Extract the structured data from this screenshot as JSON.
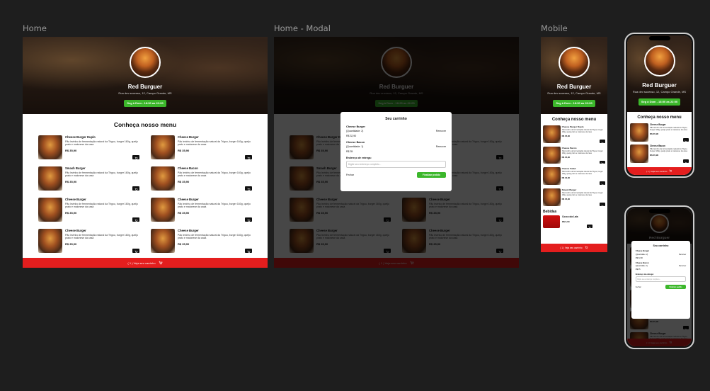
{
  "labels": {
    "home": "Home",
    "home_modal": "Home - Modal",
    "mobile": "Mobile"
  },
  "header": {
    "brand": "Red Burguer",
    "address": "Rua dev sucesso, 12, Campo Grande, MS",
    "hours": "Seg à Dom - 18:00 as 22:00"
  },
  "menu": {
    "title": "Conheça nosso menu",
    "desc": "Pão levinho de fermentação natural da Trigou, burger 160g, queijo prato e maionese da casa",
    "items": [
      {
        "name": "Cheese Burger Duplo",
        "price": "R$ 35,90"
      },
      {
        "name": "Cheese Burger",
        "price": "R$ 35,90"
      },
      {
        "name": "Smash Burger",
        "price": "R$ 35,90"
      },
      {
        "name": "Cheese Bacon",
        "price": "R$ 35,90"
      },
      {
        "name": "Cheese Burger",
        "price": "R$ 35,90"
      },
      {
        "name": "Cheese Burger",
        "price": "R$ 35,90"
      },
      {
        "name": "Cheese Burger",
        "price": "R$ 35,90"
      },
      {
        "name": "Cheese Burger",
        "price": "R$ 35,90"
      }
    ],
    "mobile_items": [
      {
        "name": "Cheese Burger Duplo",
        "price": "R$ 35,90"
      },
      {
        "name": "Cheese Bacon",
        "price": "R$ 35,90"
      },
      {
        "name": "Cheese Salad",
        "price": "R$ 32,90"
      },
      {
        "name": "Smash Burger",
        "price": "R$ 35,90"
      }
    ],
    "drinks_title": "Bebidas",
    "drink": {
      "name": "Coca cola Lata",
      "price": "R$ 6,00"
    }
  },
  "footer": {
    "label": "( 1 ) Veja seu carrinho"
  },
  "cart": {
    "title": "Seu carrinho",
    "items": [
      {
        "name": "Cheese Burger",
        "qty": "(Quantidade: 2)",
        "price": "R$ 32,90"
      },
      {
        "name": "Cheese Bacon",
        "qty": "(Quantidade: 1)",
        "price": "R$ 35"
      }
    ],
    "remove": "Remover",
    "address_label": "Endereço de entrega:",
    "address_placeholder": "Digite seu endereço completo...",
    "close": "Fechar",
    "finish": "Finalizar pedido"
  },
  "colors": {
    "accent": "#3cb72b",
    "footer": "#e41e1e",
    "canvas": "#1e1e1e"
  },
  "icons": {
    "cart": "cart-icon"
  }
}
